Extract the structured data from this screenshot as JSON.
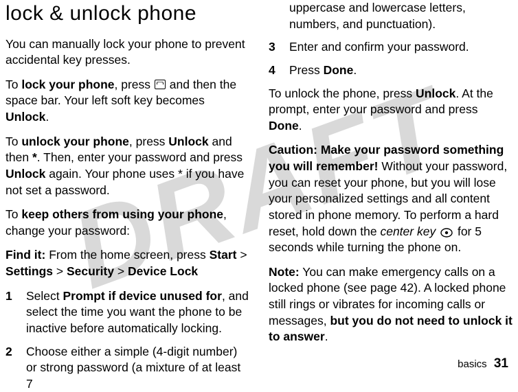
{
  "watermark": "DRAFT",
  "left": {
    "heading": "lock & unlock phone",
    "p1": "You can manually lock your phone to prevent accidental key presses.",
    "p2a": "To ",
    "p2b": "lock your phone",
    "p2c": ", press ",
    "p2d": " and then the space bar. Your left soft key becomes ",
    "p2e": "Unlock",
    "p2f": ".",
    "p3a": "To ",
    "p3b": "unlock your phone",
    "p3c": ", press ",
    "p3d": "Unlock",
    "p3e": " and then ",
    "p3f": "*",
    "p3g": ". Then, enter your password and press ",
    "p3h": "Unlock",
    "p3i": " again. Your phone uses * if you have not set a password.",
    "p4a": "To ",
    "p4b": "keep others from using your phone",
    "p4c": ", change your password:",
    "p5a": "Find it: ",
    "p5b": "From the home screen, press ",
    "p5c": "Start",
    "p5d": " > ",
    "p5e": "Settings",
    "p5f": " > ",
    "p5g": "Security",
    "p5h": " > ",
    "p5i": "Device Lock",
    "s1n": "1",
    "s1a": "Select ",
    "s1b": "Prompt if device unused for",
    "s1c": ", and select the time you want the phone to be inactive before automatically locking.",
    "s2n": "2",
    "s2": "Choose either a simple (4-digit number) or strong password (a mixture of at least 7"
  },
  "right": {
    "cont": "uppercase and lowercase letters, numbers, and punctuation).",
    "s3n": "3",
    "s3": "Enter and confirm your password.",
    "s4n": "4",
    "s4a": "Press ",
    "s4b": "Done",
    "s4c": ".",
    "p6a": "To unlock the phone, press ",
    "p6b": "Unlock",
    "p6c": ". At the prompt, enter your password and press ",
    "p6d": "Done",
    "p6e": ".",
    "p7a": "Caution: Make your password something you will remember!",
    "p7b": " Without your password, you can reset your phone, but you will lose your personalized settings and all content stored in phone memory. To perform a hard reset, hold down the ",
    "p7c": "center key",
    "p7d": " for 5 seconds while turning the phone on.",
    "p8a": "Note:",
    "p8b": " You can make emergency calls on a locked phone (see page 42). A locked phone still rings or vibrates for incoming calls or messages, ",
    "p8c": "but you do not need to unlock it to answer",
    "p8d": "."
  },
  "footer": {
    "section": "basics",
    "page": "31"
  }
}
